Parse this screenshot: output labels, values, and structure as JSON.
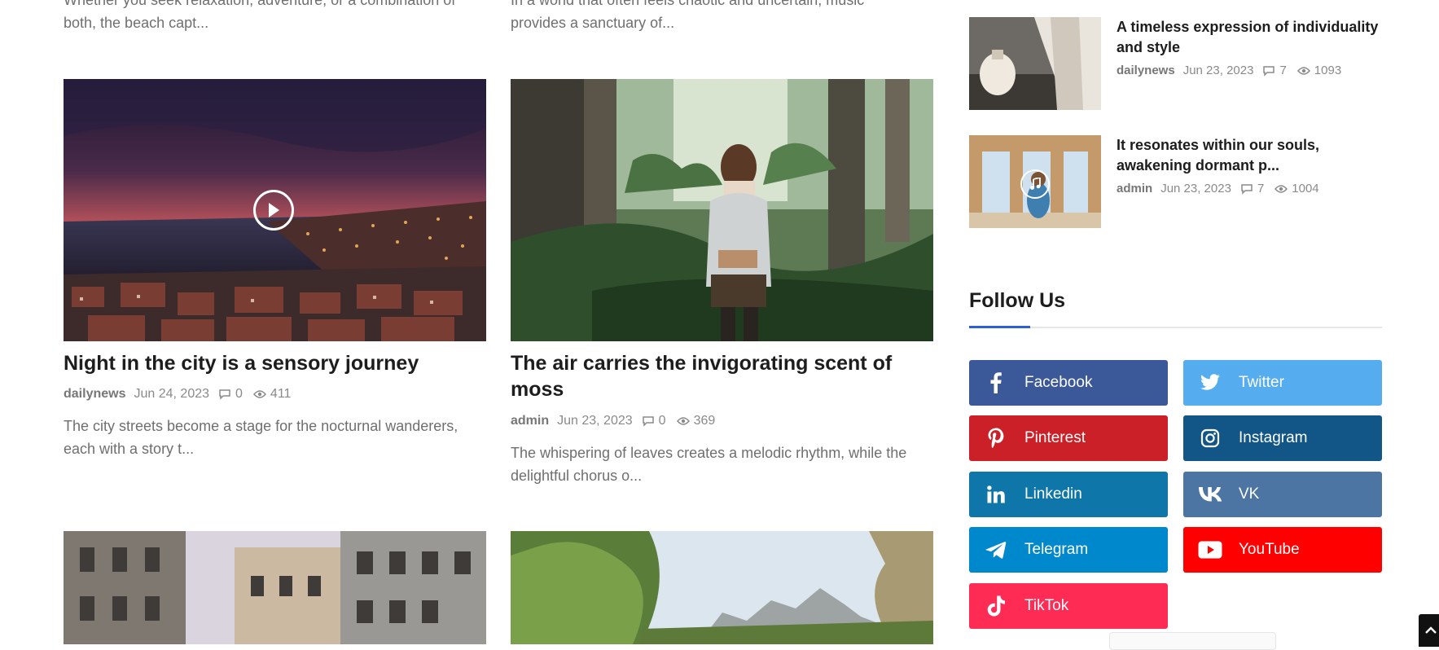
{
  "top_excerpts": [
    {
      "line1": "Whether you seek relaxation, adventure, or a combination of",
      "line2": "both, the beach capt..."
    },
    {
      "line1": "In a world that often feels chaotic and uncertain, music",
      "line2": "provides a sanctuary of..."
    }
  ],
  "cards": [
    {
      "title": "Night in the city is a sensory journey",
      "author": "dailynews",
      "date": "Jun 24, 2023",
      "comments": "0",
      "views": "411",
      "excerpt_line1": "The city streets become a stage for the nocturnal wanderers,",
      "excerpt_line2": "each with a story t...",
      "media": "video"
    },
    {
      "title_line1": "The air carries the invigorating scent of",
      "title_line2": "moss",
      "author": "admin",
      "date": "Jun 23, 2023",
      "comments": "0",
      "views": "369",
      "excerpt_line1": "The whispering of leaves creates a melodic rhythm, while the",
      "excerpt_line2": "delightful chorus o..."
    }
  ],
  "sidebar_posts": [
    {
      "title_line1": "A timeless expression of individuality",
      "title_line2": "and style",
      "author": "dailynews",
      "date": "Jun 23, 2023",
      "comments": "7",
      "views": "1093"
    },
    {
      "title_line1": "It resonates within our souls,",
      "title_line2": "awakening dormant p...",
      "author": "admin",
      "date": "Jun 23, 2023",
      "comments": "7",
      "views": "1004",
      "media": "audio"
    }
  ],
  "follow_us": {
    "title": "Follow Us",
    "networks": [
      {
        "label": "Facebook",
        "icon": "facebook-icon",
        "color": "#3b5998"
      },
      {
        "label": "Twitter",
        "icon": "twitter-icon",
        "color": "#55acee"
      },
      {
        "label": "Pinterest",
        "icon": "pinterest-icon",
        "color": "#cb2027"
      },
      {
        "label": "Instagram",
        "icon": "instagram-icon",
        "color": "#125688"
      },
      {
        "label": "Linkedin",
        "icon": "linkedin-icon",
        "color": "#0e76a8"
      },
      {
        "label": "VK",
        "icon": "vk-icon",
        "color": "#4c75a3"
      },
      {
        "label": "Telegram",
        "icon": "telegram-icon",
        "color": "#0088cc"
      },
      {
        "label": "YouTube",
        "icon": "youtube-icon",
        "color": "#ff0000"
      },
      {
        "label": "TikTok",
        "icon": "tiktok-icon",
        "color": "#fe2c55"
      }
    ]
  },
  "colors": {
    "accent": "#2f5fd6",
    "text": "#1d1d1d",
    "muted": "#6f6f6f"
  }
}
